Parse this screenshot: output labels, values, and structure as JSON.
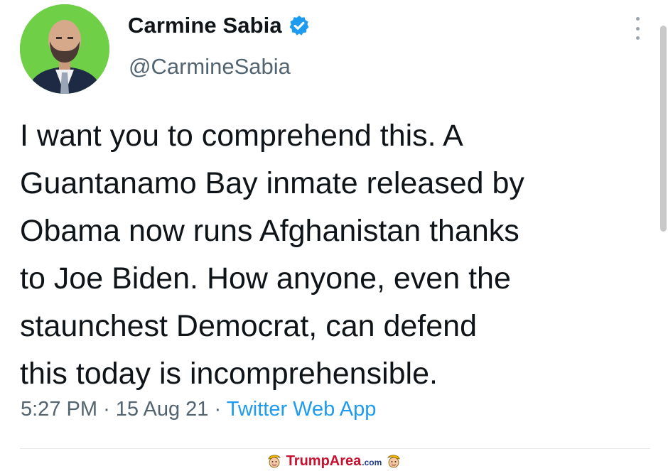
{
  "tweet": {
    "author_name": "Carmine Sabia",
    "author_handle": "@CarmineSabia",
    "text_lines": [
      "I want you to comprehend this. A",
      "Guantanamo Bay inmate released by",
      "Obama now runs Afghanistan thanks",
      "to Joe Biden. How anyone, even the",
      "staunchest Democrat, can defend",
      "this today is incomprehensible."
    ],
    "time": "5:27 PM",
    "separator": "·",
    "date": "15 Aug 21",
    "source": "Twitter Web App"
  },
  "watermark": {
    "brand": "TrumpArea",
    "tld": ".com"
  },
  "icons": {
    "verified": "verified-badge-icon",
    "more": "more-options-icon",
    "mascot": "trump-mascot-icon"
  },
  "colors": {
    "avatar_background": "#6fcf47",
    "verified_badge": "#1d9bf0",
    "link": "#1d9bf0",
    "secondary_text": "#536471",
    "brand": "#c8102e"
  }
}
